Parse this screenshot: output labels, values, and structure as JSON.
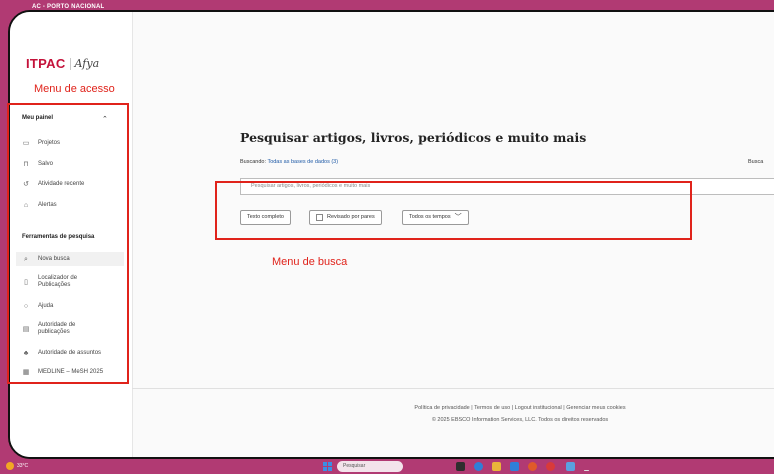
{
  "browser": {
    "tab_title": "AC - PORTO NACIONAL"
  },
  "logo": {
    "brand": "ITPAC",
    "partner": "Afya"
  },
  "annotations": {
    "menu_acesso": "Menu de acesso",
    "menu_busca": "Menu de busca"
  },
  "sidebar": {
    "section1": "Meu painel",
    "items1": [
      {
        "label": "Projetos",
        "icon": "folder-icon"
      },
      {
        "label": "Salvo",
        "icon": "bookmark-icon"
      },
      {
        "label": "Atividade recente",
        "icon": "history-icon"
      },
      {
        "label": "Alertas",
        "icon": "bell-icon"
      }
    ],
    "section2": "Ferramentas de pesquisa",
    "items2": [
      {
        "label": "Nova busca",
        "icon": "search-icon"
      },
      {
        "label": "Localizador de Publicações",
        "icon": "document-icon"
      },
      {
        "label": "Ajuda",
        "icon": "help-icon"
      },
      {
        "label": "Autoridade de publicações",
        "icon": "book-icon"
      },
      {
        "label": "Autoridade de assuntos",
        "icon": "hierarchy-icon"
      },
      {
        "label": "MEDLINE – MeSH 2025",
        "icon": "list-icon"
      }
    ]
  },
  "main": {
    "title": "Pesquisar artigos, livros, periódicos e muito mais",
    "searching_prefix": "Buscando:",
    "searching_link": "Todas as bases de dados (3)",
    "busca_right": "Busca",
    "search_placeholder": "Pesquisar artigos, livros, periódicos e muito mais",
    "filters": {
      "full_text": "Texto completo",
      "peer_reviewed": "Revisado por pares",
      "all_time": "Todos os tempos"
    }
  },
  "footer": {
    "links": "Política de privacidade | Termos de uso | Logout institucional | Gerenciar meus cookies",
    "copyright": "© 2025 EBSCO Information Services, LLC. Todos os direitos reservados"
  },
  "taskbar": {
    "temperature": "33°C",
    "search": "Pesquisar"
  },
  "colors": {
    "accent": "#b13a73",
    "annotation": "#e0231b",
    "brand": "#c4123a",
    "link": "#1f5aa6"
  }
}
